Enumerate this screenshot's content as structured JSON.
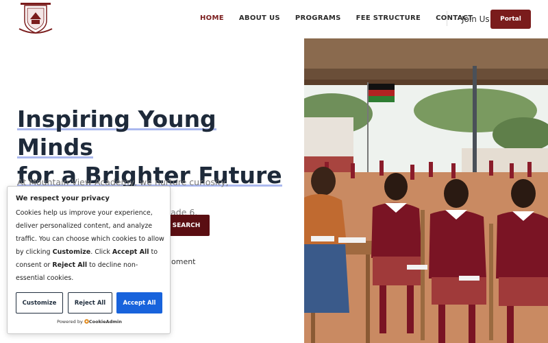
{
  "nav": {
    "items": [
      {
        "label": "HOME",
        "active": true
      },
      {
        "label": "ABOUT US"
      },
      {
        "label": "PROGRAMS"
      },
      {
        "label": "FEE STRUCTURE"
      },
      {
        "label": "CONTACT"
      }
    ],
    "join_label": "Join Us",
    "portal_label": "Portal"
  },
  "hero": {
    "title_line1": "Inspiring Young Minds",
    "title_line2": "for a Brighter Future",
    "description_line1": "At Mountain View Academy, we nurture curiosity, creativity, and strong",
    "description_line2": "rade 6.",
    "search_label": "SEARCH",
    "partial_text": "oment"
  },
  "cookie": {
    "title": "We respect your privacy",
    "body_part1": "Cookies help us improve your experience, deliver personalized content, and analyze traffic. You can choose which cookies to allow by clicking ",
    "customize_word": "Customize",
    "body_part2": ". Click ",
    "accept_word": "Accept All",
    "body_part3": " to consent or ",
    "reject_word": "Reject All",
    "body_part4": " to decline non-essential cookies.",
    "customize_button": "Customize",
    "reject_button": "Reject All",
    "accept_button": "Accept All",
    "powered_by": "Powered by",
    "powered_brand": "CookieAdmin"
  },
  "colors": {
    "brand": "#7a1c1c",
    "search": "#5a0e12",
    "accept": "#1863dc",
    "title": "#1e2a3a",
    "underline": "#aab8ee"
  },
  "icons": {
    "logo": "school-crest-logo",
    "cookie_brand": "cookieadmin-logo-icon"
  }
}
